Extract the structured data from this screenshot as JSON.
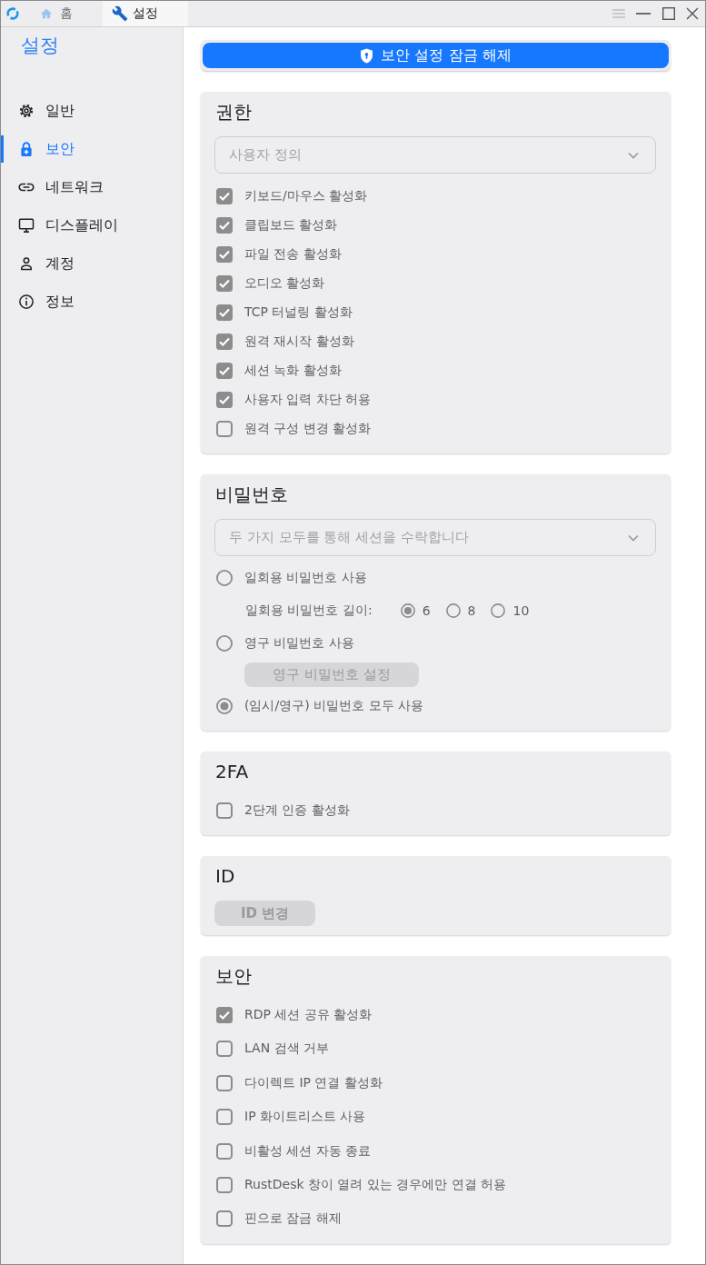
{
  "title_bar": {
    "tabs": [
      {
        "label": "홈",
        "selected": false
      },
      {
        "label": "설정",
        "selected": true
      }
    ]
  },
  "sidebar": {
    "title": "설정",
    "items": [
      {
        "label": "일반",
        "selected": false
      },
      {
        "label": "보안",
        "selected": true
      },
      {
        "label": "네트워크",
        "selected": false
      },
      {
        "label": "디스플레이",
        "selected": false
      },
      {
        "label": "계정",
        "selected": false
      },
      {
        "label": "정보",
        "selected": false
      }
    ]
  },
  "unlock_button": {
    "label": "보안 설정 잠금 해제"
  },
  "sections": [
    {
      "kind": "permissions",
      "title": "권한",
      "dropdown": {
        "value": "사용자 정의",
        "disabled": true
      },
      "options": [
        {
          "label": "키보드/마우스 활성화",
          "checked": true
        },
        {
          "label": "클립보드 활성화",
          "checked": true
        },
        {
          "label": "파일 전송 활성화",
          "checked": true
        },
        {
          "label": "오디오 활성화",
          "checked": true
        },
        {
          "label": "TCP 터널링 활성화",
          "checked": true
        },
        {
          "label": "원격 재시작 활성화",
          "checked": true
        },
        {
          "label": "세션 녹화 활성화",
          "checked": true
        },
        {
          "label": "사용자 입력 차단 허용",
          "checked": true
        },
        {
          "label": "원격 구성 변경 활성화",
          "checked": false
        }
      ]
    },
    {
      "kind": "password",
      "title": "비밀번호",
      "dropdown": {
        "value": "두 가지 모두를 통해 세션을 수락합니다",
        "disabled": true
      },
      "items": [
        {
          "kind": "radio",
          "label": "일회용 비밀번호 사용",
          "selected": false
        },
        {
          "kind": "length",
          "label": "일회용 비밀번호 길이:",
          "options": [
            {
              "label": "6",
              "selected": true
            },
            {
              "label": "8",
              "selected": false
            },
            {
              "label": "10",
              "selected": false
            }
          ]
        },
        {
          "kind": "radio",
          "label": "영구 비밀번호 사용",
          "selected": false
        },
        {
          "kind": "button",
          "label": "영구 비밀번호 설정",
          "disabled": true
        },
        {
          "kind": "radio",
          "label": "(임시/영구) 비밀번호 모두 사용",
          "selected": true
        }
      ]
    },
    {
      "kind": "checklist",
      "title": "2FA",
      "options": [
        {
          "label": "2단계 인증 활성화",
          "checked": false
        }
      ]
    },
    {
      "kind": "action",
      "title": "ID",
      "button": {
        "label": "ID 변경",
        "disabled": true
      }
    },
    {
      "kind": "checklist",
      "title": "보안",
      "options": [
        {
          "label": "RDP 세션 공유 활성화",
          "checked": true
        },
        {
          "label": "LAN 검색 거부",
          "checked": false
        },
        {
          "label": "다이렉트 IP 연결 활성화",
          "checked": false
        },
        {
          "label": "IP 화이트리스트 사용",
          "checked": false
        },
        {
          "label": "비활성 세션 자동 종료",
          "checked": false
        },
        {
          "label": "RustDesk 창이 열려 있는 경우에만 연결 허용",
          "checked": false
        },
        {
          "label": "핀으로 잠금 해제",
          "checked": false
        }
      ]
    }
  ]
}
